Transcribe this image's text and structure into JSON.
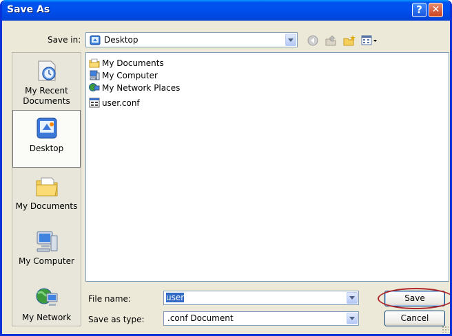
{
  "window": {
    "title": "Save As",
    "help_glyph": "?",
    "close_glyph": "✕"
  },
  "toolbar": {
    "save_in_label": "Save in:",
    "location": "Desktop",
    "icons": [
      "back-arrow-icon",
      "up-folder-icon",
      "new-folder-icon",
      "views-menu-icon"
    ]
  },
  "places": [
    {
      "line1": "My Recent",
      "line2": "Documents",
      "icon": "recent-documents-icon"
    },
    {
      "line1": "Desktop",
      "icon": "desktop-icon",
      "selected": true
    },
    {
      "line1": "My Documents",
      "icon": "my-documents-icon"
    },
    {
      "line1": "My Computer",
      "icon": "my-computer-icon"
    },
    {
      "line1": "My Network",
      "icon": "my-network-icon"
    }
  ],
  "files": [
    {
      "name": "My Documents",
      "icon": "documents-folder-icon"
    },
    {
      "name": "My Computer",
      "icon": "computer-icon"
    },
    {
      "name": "My Network Places",
      "icon": "network-icon"
    },
    {
      "name": "user.conf",
      "icon": "conf-file-icon"
    }
  ],
  "form": {
    "file_name_label": "File name:",
    "file_name_value": "user",
    "save_as_type_label": "Save as type:",
    "save_as_type_value": ".conf Document"
  },
  "buttons": {
    "save": "Save",
    "cancel": "Cancel"
  },
  "colors": {
    "title_bar": "#0053ee",
    "frame": "#0831d9",
    "selection": "#316ac5",
    "highlight_ring": "#b0282c"
  }
}
